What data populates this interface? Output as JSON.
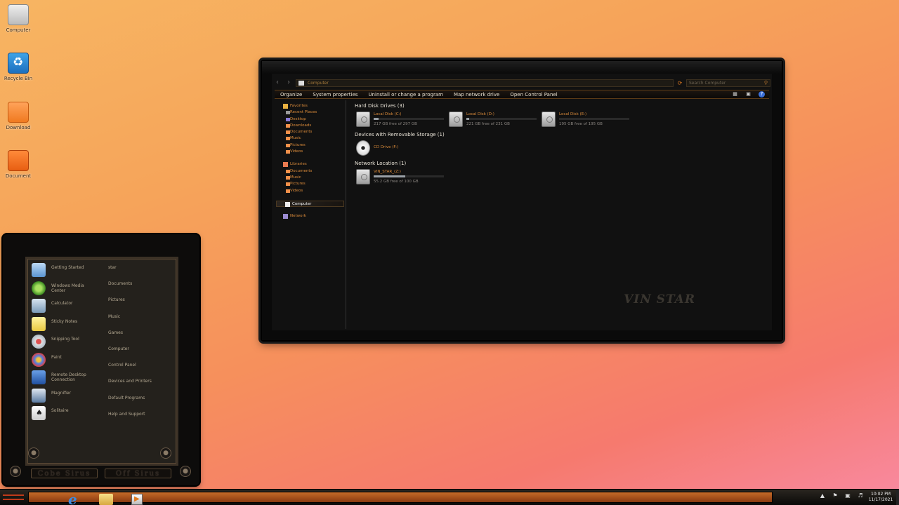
{
  "desktop": {
    "icons": [
      {
        "label": "Computer",
        "icon": "computer-icon"
      },
      {
        "label": "Recycle Bin",
        "icon": "recycle-bin-icon"
      },
      {
        "label": "Download",
        "icon": "download-folder-icon"
      },
      {
        "label": "Document",
        "icon": "document-folder-icon"
      }
    ]
  },
  "explorer": {
    "address": "Computer",
    "search_placeholder": "Search Computer",
    "toolbar": [
      "Organize",
      "System properties",
      "Uninstall or change a program",
      "Map network drive",
      "Open Control Panel"
    ],
    "nav": {
      "favorites": {
        "title": "Favorites",
        "items": [
          "Recent Places",
          "Desktop",
          "Downloads",
          "Documents",
          "Music",
          "Pictures",
          "Videos"
        ]
      },
      "libraries": {
        "title": "Libraries",
        "items": [
          "Documents",
          "Music",
          "Pictures",
          "Videos"
        ]
      },
      "computer": "Computer",
      "network": "Network"
    },
    "groups": {
      "hard_disk": "Hard Disk Drives (3)",
      "removable": "Devices with Removable Storage (1)",
      "network": "Network Location (1)"
    },
    "drives": [
      {
        "name": "Local Disk (C:)",
        "free": "217 GB free of 297 GB",
        "used_fraction": 0.07
      },
      {
        "name": "Local Disk (D:)",
        "free": "221 GB free of 231 GB",
        "used_fraction": 0.04
      },
      {
        "name": "Local Disk (E:)",
        "free": "195 GB free of 195 GB",
        "used_fraction": 0.0
      }
    ],
    "cd": {
      "name": "CD Drive (F:)"
    },
    "network_drive": {
      "name": "VIN_STAR_(Z:)",
      "free": "55.2 GB free of 100 GB",
      "used_fraction": 0.45
    },
    "watermark": "VIN STAR"
  },
  "startmenu": {
    "programs": [
      {
        "label": "Getting Started",
        "icon": "getting-started-icon"
      },
      {
        "label": "Windows Media Center",
        "icon": "media-center-icon"
      },
      {
        "label": "Calculator",
        "icon": "calculator-icon"
      },
      {
        "label": "Sticky Notes",
        "icon": "sticky-notes-icon"
      },
      {
        "label": "Snipping Tool",
        "icon": "snipping-tool-icon"
      },
      {
        "label": "Paint",
        "icon": "paint-icon"
      },
      {
        "label": "Remote Desktop Connection",
        "icon": "remote-desktop-icon"
      },
      {
        "label": "Magnifier",
        "icon": "magnifier-icon"
      },
      {
        "label": "Solitaire",
        "icon": "solitaire-icon"
      }
    ],
    "places": [
      "star",
      "Documents",
      "Pictures",
      "Music",
      "Games",
      "Computer",
      "Control Panel",
      "Devices and Printers",
      "Default Programs",
      "Help and Support"
    ],
    "buttons": [
      "Cobe Sirus",
      "Off Sirus"
    ]
  },
  "taskbar": {
    "time": "10:02 PM",
    "date": "11/17/2021"
  }
}
